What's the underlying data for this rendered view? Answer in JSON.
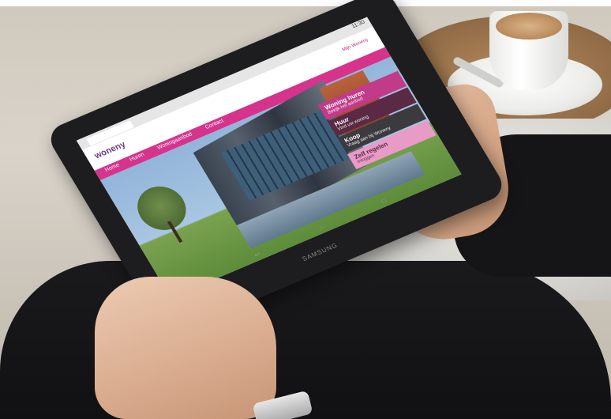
{
  "device": {
    "brand": "SAMSUNG",
    "status_time": "11:30",
    "nav_icons": [
      "back-icon",
      "home-icon",
      "recent-apps-icon"
    ]
  },
  "website": {
    "logo": "woneny",
    "top_link": "Mijn Woneny",
    "nav": [
      "Home",
      "Huren",
      "Woningaanbod",
      "Contact"
    ],
    "ctas": [
      {
        "title": "Woning huren",
        "subtitle": "Bekijk het aanbod"
      },
      {
        "title": "Huur",
        "subtitle": "Vind uw woning"
      },
      {
        "title": "Koop",
        "subtitle": "Vraag aan bij Woneny"
      },
      {
        "title": "Zelf regelen",
        "subtitle": "Inloggen"
      }
    ]
  },
  "colors": {
    "accent": "#d6338d",
    "cta_dark": "#5a2a44"
  }
}
